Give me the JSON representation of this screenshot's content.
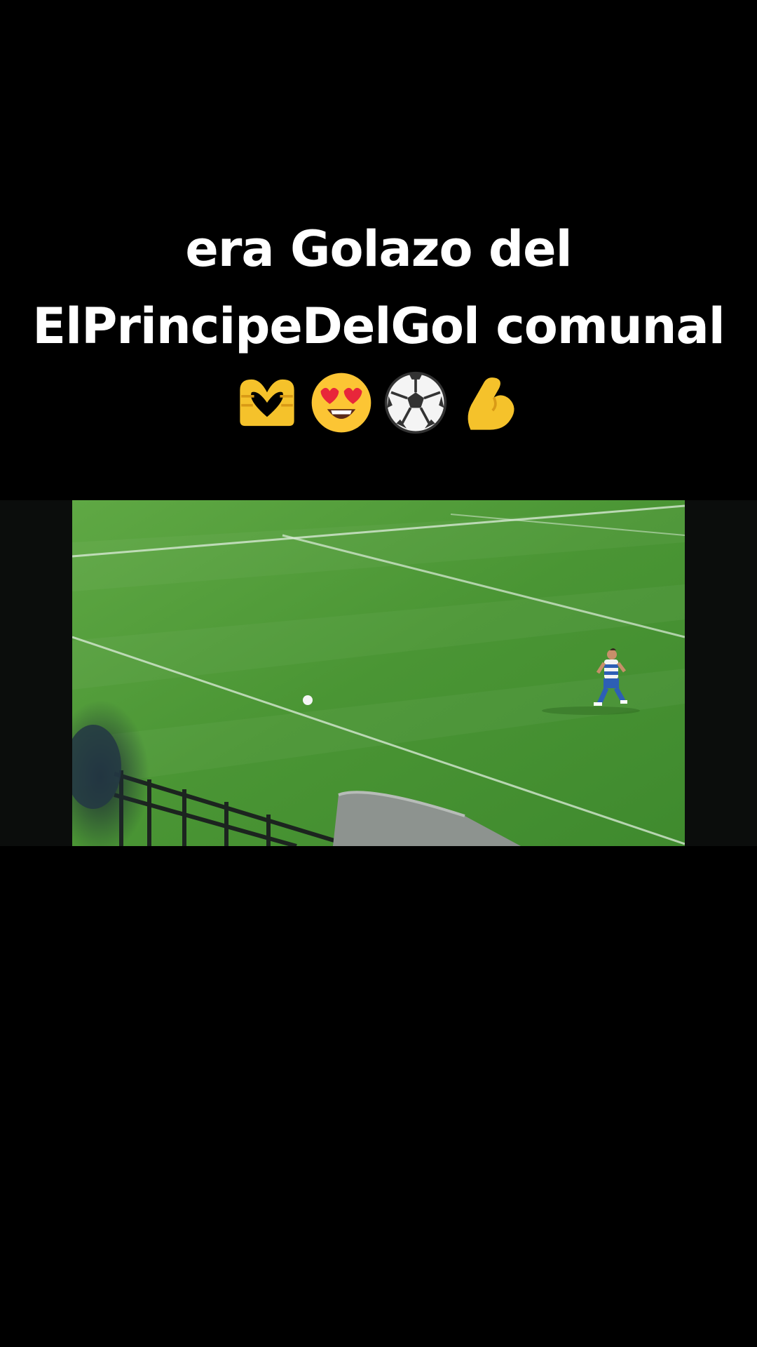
{
  "caption": {
    "line1": "era Golazo del",
    "line2": "ElPrincipeDelGol comunal"
  },
  "emojis": [
    "heart-hands-icon",
    "heart-eyes-icon",
    "soccer-ball-icon",
    "flexed-biceps-icon"
  ],
  "colors": {
    "background": "#000000",
    "text": "#ffffff",
    "pitch": "#4f9a38"
  }
}
